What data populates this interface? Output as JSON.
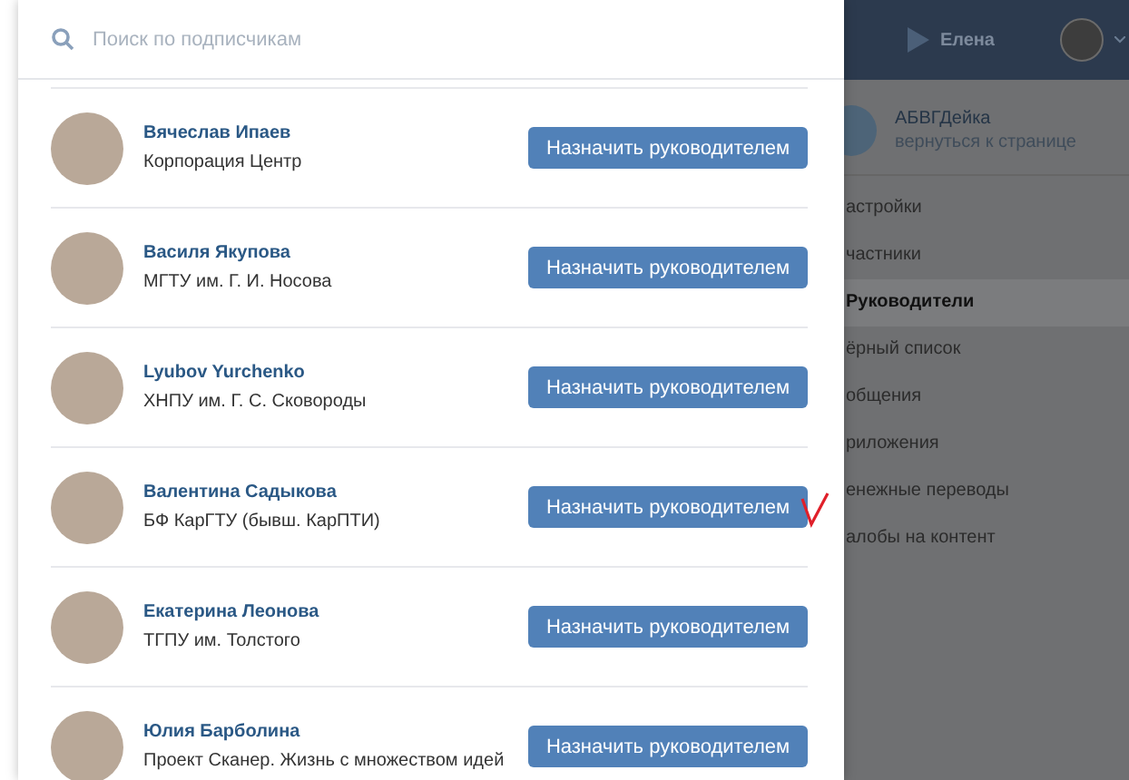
{
  "search": {
    "placeholder": "Поиск по подписчикам"
  },
  "subscribers": [
    {
      "name": "Вячеслав Ипаев",
      "info": "Корпорация Центр",
      "button": "Назначить руководителем",
      "marked": false
    },
    {
      "name": "Василя Якупова",
      "info": "МГТУ им. Г. И. Носова",
      "button": "Назначить руководителем",
      "marked": false
    },
    {
      "name": "Lyubov Yurchenko",
      "info": "ХНПУ им. Г. С. Сковороды",
      "button": "Назначить руководителем",
      "marked": false
    },
    {
      "name": "Валентина Садыкова",
      "info": "БФ КарГТУ (бывш. КарПТИ)",
      "button": "Назначить руководителем",
      "marked": true
    },
    {
      "name": "Екатерина Леонова",
      "info": "ТГПУ им. Толстого",
      "button": "Назначить руководителем",
      "marked": false
    },
    {
      "name": "Юлия Барболина",
      "info": "Проект Сканер. Жизнь с множеством идей",
      "button": "Назначить руководителем",
      "marked": false
    }
  ],
  "header": {
    "user": "Елена"
  },
  "group": {
    "name": "АБВГДейка",
    "link": "вернуться к странице"
  },
  "menu": [
    {
      "label": "астройки",
      "selected": false
    },
    {
      "label": "частники",
      "selected": false
    },
    {
      "label": "Руководители",
      "selected": true
    },
    {
      "label": "ёрный список",
      "selected": false
    },
    {
      "label": "общения",
      "selected": false
    },
    {
      "label": "риложения",
      "selected": false
    },
    {
      "label": "енежные переводы",
      "selected": false
    },
    {
      "label": "алобы на контент",
      "selected": false
    }
  ]
}
